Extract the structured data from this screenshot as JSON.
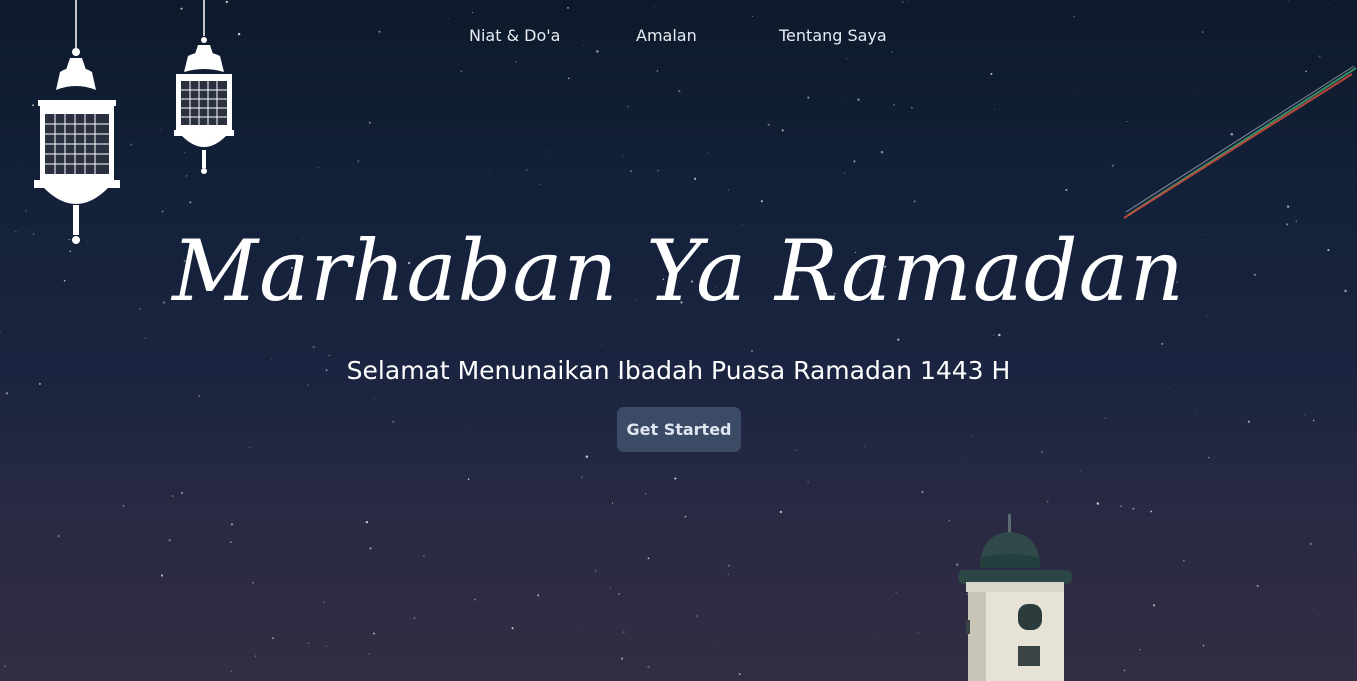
{
  "nav": {
    "items": [
      {
        "label": "Niat & Do'a"
      },
      {
        "label": "Amalan"
      },
      {
        "label": "Tentang Saya"
      }
    ]
  },
  "hero": {
    "title": "Marhaban Ya Ramadan",
    "subtitle": "Selamat Menunaikan Ibadah Puasa Ramadan 1443 H",
    "cta_label": "Get Started"
  },
  "colors": {
    "sky_top": "#0d1a2b",
    "sky_bottom": "#332d42",
    "button_bg": "#3b4b66",
    "text": "#ffffff"
  },
  "icons": [
    "lantern-icon",
    "mosque-minaret-icon",
    "meteor-trail"
  ]
}
